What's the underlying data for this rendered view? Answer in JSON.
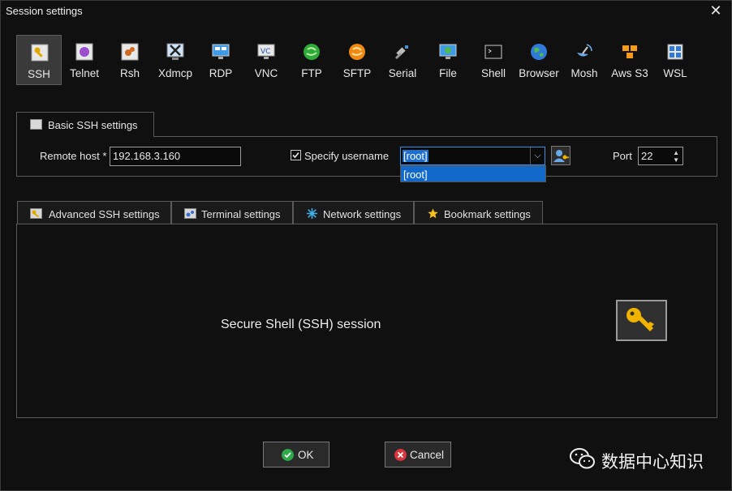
{
  "window": {
    "title": "Session settings",
    "close_symbol": "✕"
  },
  "toolbar": {
    "items": [
      {
        "label": "SSH",
        "icon": "ssh-key-icon",
        "active": true
      },
      {
        "label": "Telnet",
        "icon": "telnet-icon"
      },
      {
        "label": "Rsh",
        "icon": "rsh-icon"
      },
      {
        "label": "Xdmcp",
        "icon": "xdmcp-icon"
      },
      {
        "label": "RDP",
        "icon": "rdp-icon"
      },
      {
        "label": "VNC",
        "icon": "vnc-icon"
      },
      {
        "label": "FTP",
        "icon": "ftp-icon"
      },
      {
        "label": "SFTP",
        "icon": "sftp-icon"
      },
      {
        "label": "Serial",
        "icon": "serial-icon"
      },
      {
        "label": "File",
        "icon": "file-icon"
      },
      {
        "label": "Shell",
        "icon": "shell-icon"
      },
      {
        "label": "Browser",
        "icon": "browser-icon"
      },
      {
        "label": "Mosh",
        "icon": "mosh-icon"
      },
      {
        "label": "Aws S3",
        "icon": "aws-s3-icon"
      },
      {
        "label": "WSL",
        "icon": "wsl-icon"
      }
    ]
  },
  "basic": {
    "tab_label": "Basic SSH settings",
    "remote_host_label": "Remote host *",
    "remote_host_value": "192.168.3.160",
    "specify_username_label": "Specify username",
    "specify_username_checked": true,
    "username_value": "[root]",
    "username_options": [
      "[root]"
    ],
    "port_label": "Port",
    "port_value": "22"
  },
  "tabs": [
    {
      "label": "Advanced SSH settings",
      "icon": "wrench-icon"
    },
    {
      "label": "Terminal settings",
      "icon": "terminal-icon"
    },
    {
      "label": "Network settings",
      "icon": "network-icon"
    },
    {
      "label": "Bookmark settings",
      "icon": "star-icon"
    }
  ],
  "main": {
    "session_text": "Secure Shell (SSH) session"
  },
  "buttons": {
    "ok": "OK",
    "cancel": "Cancel"
  },
  "watermark": {
    "text": "数据中心知识"
  },
  "colors": {
    "accent": "#1e6fd0",
    "ok_green": "#2eaa4a",
    "cancel_red": "#d9363e",
    "key_gold": "#f0b400"
  }
}
